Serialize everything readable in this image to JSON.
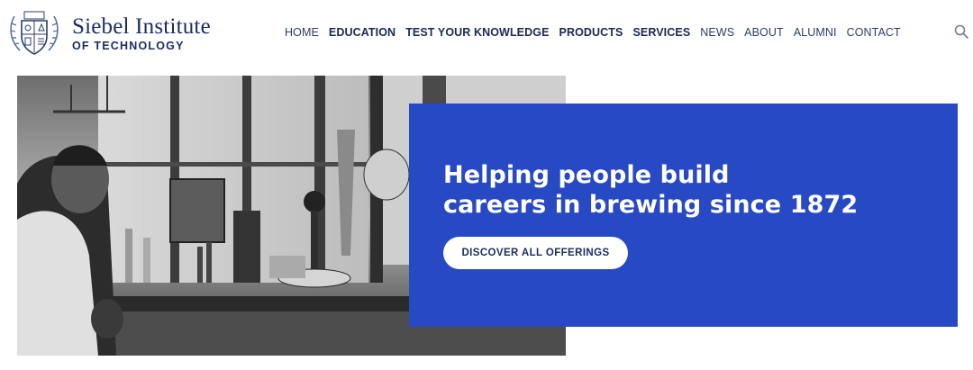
{
  "brand": {
    "name": "Siebel Institute",
    "subtitle": "OF TECHNOLOGY",
    "crest_year": "1872"
  },
  "nav": {
    "items": [
      {
        "label": "HOME",
        "bold": false
      },
      {
        "label": "EDUCATION",
        "bold": true
      },
      {
        "label": "TEST YOUR KNOWLEDGE",
        "bold": true
      },
      {
        "label": "PRODUCTS",
        "bold": true
      },
      {
        "label": "SERVICES",
        "bold": true
      },
      {
        "label": "NEWS",
        "bold": false
      },
      {
        "label": "ABOUT",
        "bold": false
      },
      {
        "label": "ALUMNI",
        "bold": false
      },
      {
        "label": "CONTACT",
        "bold": false
      }
    ],
    "search_icon": "search-icon"
  },
  "hero": {
    "headline_line1": "Helping people build",
    "headline_line2": "careers in brewing since 1872",
    "cta_label": "DISCOVER ALL OFFERINGS",
    "photo": "black-and-white laboratory photo"
  },
  "colors": {
    "brand_navy": "#1b2f63",
    "hero_blue": "#2849c4",
    "white": "#ffffff"
  }
}
